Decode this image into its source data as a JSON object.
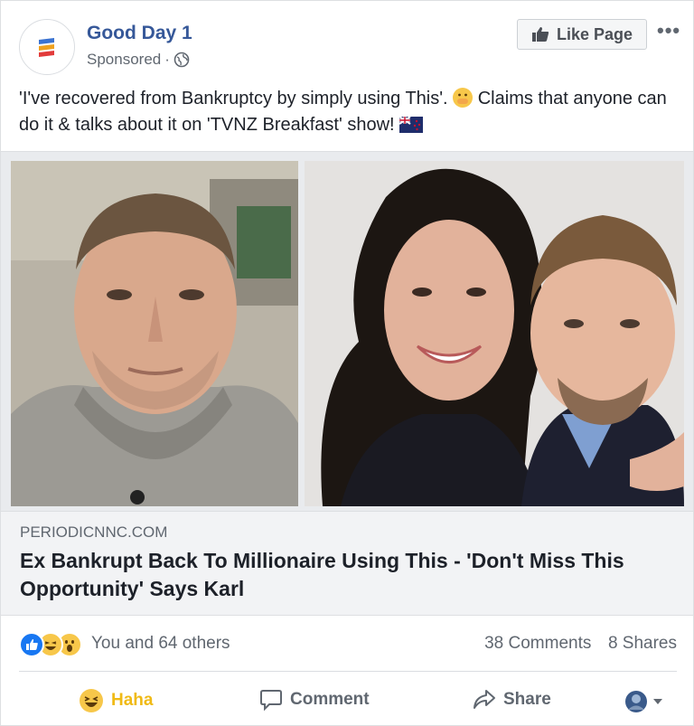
{
  "post": {
    "page_name": "Good Day 1",
    "sponsored": "Sponsored",
    "sponsored_sep": "·",
    "like_page": "Like Page",
    "more": "•••",
    "text_part1": "'I've recovered from Bankruptcy by simply using This'.",
    "text_part2": "Claims that anyone can do it & talks about it on 'TVNZ Breakfast' show!"
  },
  "link": {
    "domain": "PERIODICNNC.COM",
    "headline": "Ex Bankrupt Back To Millionaire Using This - 'Don't Miss This Opportunity' Says Karl"
  },
  "engagement": {
    "reactions": "You and 64 others",
    "comments": "38 Comments",
    "shares": "8 Shares"
  },
  "actions": {
    "haha": "Haha",
    "comment": "Comment",
    "share": "Share"
  },
  "colors": {
    "link_blue": "#365899",
    "haha_yellow": "#f0ba15",
    "gray_text": "#606770"
  }
}
